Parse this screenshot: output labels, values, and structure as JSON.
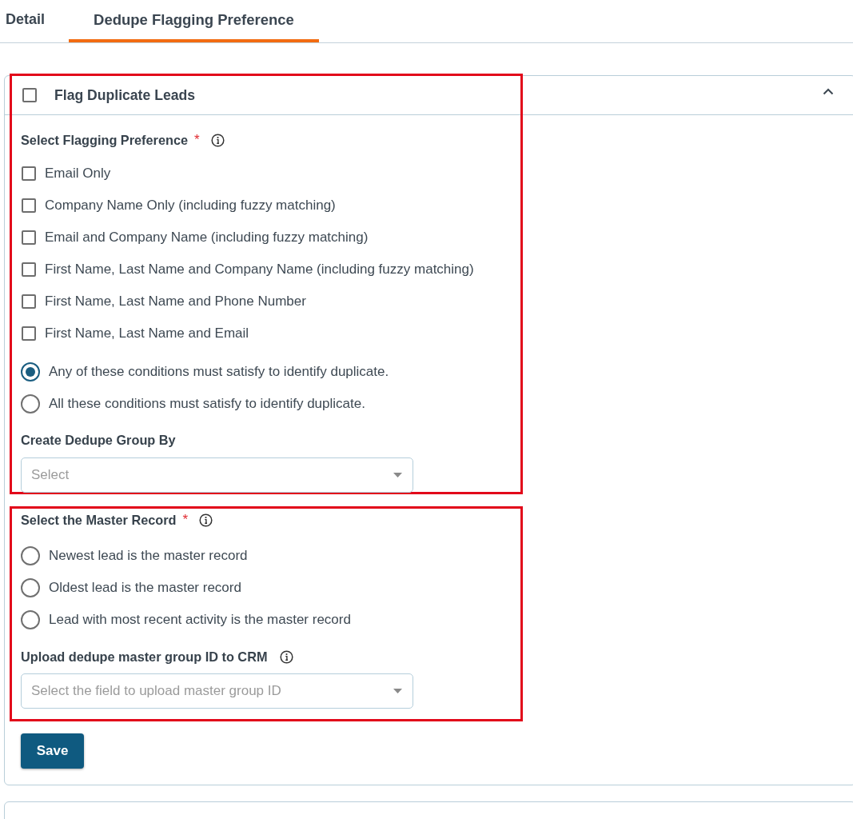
{
  "tabs": [
    {
      "label": "Detail",
      "selected": false
    },
    {
      "label": "Dedupe Flagging Preference",
      "selected": true
    }
  ],
  "panel": {
    "title": "Flag Duplicate Leads",
    "checked": false,
    "expanded": true,
    "highlighted": true,
    "flagging": {
      "label": "Select Flagging Preference",
      "required_mark": "*",
      "options": [
        {
          "label": "Email Only",
          "checked": false
        },
        {
          "label": "Company Name Only (including fuzzy matching)",
          "checked": false
        },
        {
          "label": "Email and Company Name (including fuzzy matching)",
          "checked": false
        },
        {
          "label": "First Name, Last Name and Company Name (including fuzzy matching)",
          "checked": false
        },
        {
          "label": "First Name, Last Name and Phone Number",
          "checked": false
        },
        {
          "label": "First Name, Last Name and Email",
          "checked": false
        }
      ]
    },
    "match_modes": [
      {
        "label": "Any of these conditions must satisfy to identify duplicate.",
        "selected": true
      },
      {
        "label": "All these conditions must satisfy to identify duplicate.",
        "selected": false
      }
    ],
    "group_by": {
      "label": "Create Dedupe Group By",
      "placeholder": "Select"
    },
    "master_record": {
      "highlighted": true,
      "label": "Select the Master Record",
      "required_mark": "*",
      "options": [
        {
          "label": "Newest lead is the master record",
          "selected": false
        },
        {
          "label": "Oldest lead is the master record",
          "selected": false
        },
        {
          "label": "Lead with most recent activity is the master record",
          "selected": false
        }
      ],
      "upload": {
        "label": "Upload dedupe master group ID to CRM",
        "placeholder": "Select the field to upload master group ID"
      }
    },
    "save_button": {
      "label": "Save"
    }
  }
}
